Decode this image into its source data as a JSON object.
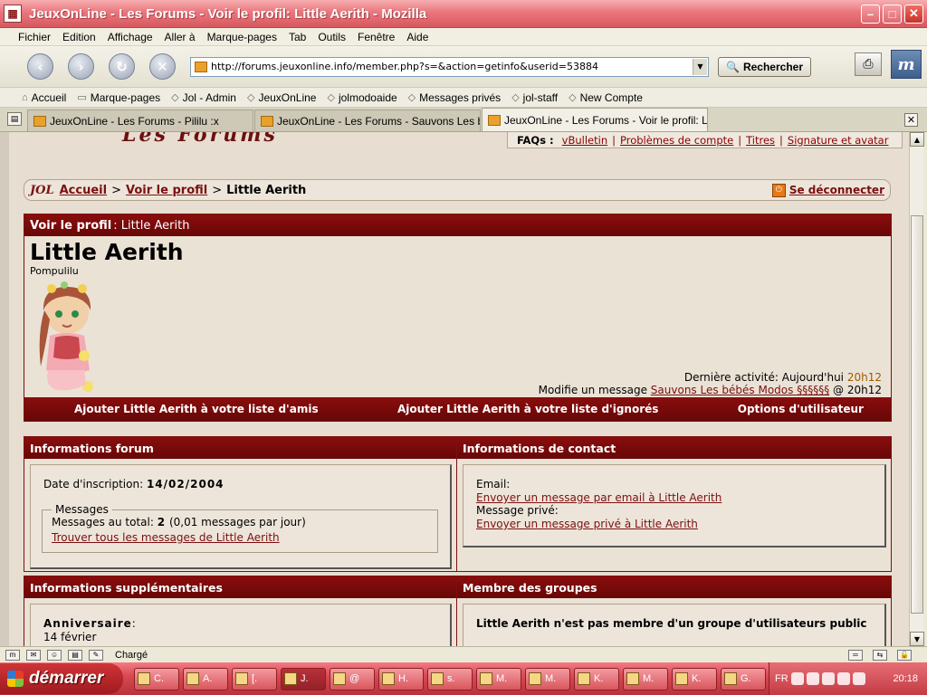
{
  "window": {
    "title": "JeuxOnLine - Les Forums - Voir le profil: Little Aerith - Mozilla"
  },
  "menu": [
    "Fichier",
    "Edition",
    "Affichage",
    "Aller à",
    "Marque-pages",
    "Tab",
    "Outils",
    "Fenêtre",
    "Aide"
  ],
  "toolbar": {
    "url": "http://forums.jeuxonline.info/member.php?s=&action=getinfo&userid=53884",
    "search_label": "Rechercher"
  },
  "bookmarks": [
    "Accueil",
    "Marque-pages",
    "Jol - Admin",
    "JeuxOnLine",
    "jolmodoaide",
    "Messages privés",
    "jol-staff",
    "New Compte"
  ],
  "tabs": [
    {
      "label": "JeuxOnLine - Les Forums - Pililu :x",
      "active": false
    },
    {
      "label": "JeuxOnLine - Les Forums - Sauvons Les bé...",
      "active": false
    },
    {
      "label": "JeuxOnLine - Les Forums - Voir le profil: Lit...",
      "active": true
    }
  ],
  "page": {
    "logo_text": "Les Forums",
    "faq": {
      "label": "FAQs :",
      "links": [
        "vBulletin",
        "Problèmes de compte",
        "Titres",
        "Signature et avatar"
      ]
    },
    "breadcrumb": {
      "logo": "JOL",
      "home": "Accueil",
      "sep1": ">",
      "profile": "Voir le profil",
      "sep2": ">",
      "current": "Little Aerith"
    },
    "logout": "Se déconnecter",
    "profile": {
      "header_label": "Voir le profil",
      "header_name": ": Little Aerith",
      "username": "Little Aerith",
      "user_title": "Pompulilu",
      "last_activity_label": "Dernière activité: Aujourd'hui",
      "last_activity_time": "20h12",
      "last_action_prefix": "Modifie un message",
      "last_action_thread": "Sauvons Les bébés Modos §§§§§§",
      "last_action_time": "@ 20h12",
      "actions": [
        "Ajouter Little Aerith à votre liste d'amis",
        "Ajouter Little Aerith à votre liste d'ignorés",
        "Options d'utilisateur"
      ]
    },
    "forum_info": {
      "title": "Informations forum",
      "join_label": "Date d'inscription:",
      "join_date": "14/02/2004",
      "messages_legend": "Messages",
      "total_label": "Messages au total:",
      "total_value": "2",
      "per_day": "(0,01 messages par jour)",
      "find_all": "Trouver tous les messages de Little Aerith"
    },
    "contact_info": {
      "title": "Informations de contact",
      "email_label": "Email:",
      "email_link": "Envoyer un message par email à Little Aerith",
      "pm_label": "Message privé:",
      "pm_link": "Envoyer un message privé à Little Aerith"
    },
    "extra_info": {
      "title": "Informations supplémentaires",
      "birthday_label": "Anniversaire",
      "birthday_colon": ":",
      "birthday_value": "14 février"
    },
    "groups": {
      "title": "Membre des groupes",
      "text": "Little Aerith n'est pas membre d'un groupe d'utilisateurs public"
    }
  },
  "status": {
    "text": "Chargé"
  },
  "taskbar": {
    "start_label": "démarrer",
    "items": [
      "C.",
      "A.",
      "[.",
      "J.",
      "@",
      "H.",
      "s.",
      "M.",
      "M.",
      "K.",
      "M.",
      "K.",
      "G."
    ],
    "active_index": 3,
    "lang": "FR",
    "clock": "20:18"
  },
  "colors": {
    "accent": "#7b1010",
    "page_bg": "#e7ddd0",
    "titlebar": "#e9767c"
  }
}
